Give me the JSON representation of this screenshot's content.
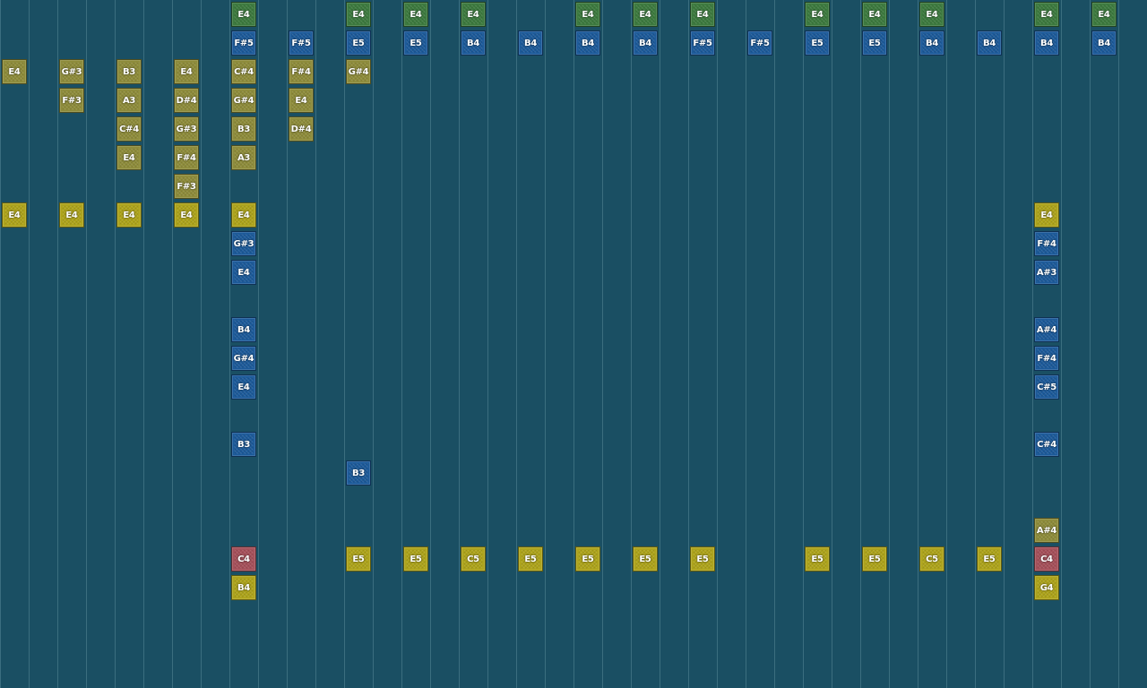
{
  "palette": {
    "green": "#3c7a3e",
    "blue": "#1c5a9a",
    "olive": "#8e8c3a",
    "yellow": "#aea41a",
    "red": "#a6505a"
  },
  "columns": [
    {
      "notes": [
        {
          "row": 2,
          "label": "E4",
          "color": "olive"
        },
        {
          "row": 7,
          "label": "E4",
          "color": "yellow"
        }
      ]
    },
    {
      "notes": []
    },
    {
      "notes": [
        {
          "row": 2,
          "label": "G#3",
          "color": "olive"
        },
        {
          "row": 3,
          "label": "F#3",
          "color": "olive"
        },
        {
          "row": 7,
          "label": "E4",
          "color": "yellow"
        }
      ]
    },
    {
      "notes": []
    },
    {
      "notes": [
        {
          "row": 2,
          "label": "B3",
          "color": "olive"
        },
        {
          "row": 3,
          "label": "A3",
          "color": "olive"
        },
        {
          "row": 4,
          "label": "C#4",
          "color": "olive"
        },
        {
          "row": 5,
          "label": "E4",
          "color": "olive"
        },
        {
          "row": 7,
          "label": "E4",
          "color": "yellow"
        }
      ]
    },
    {
      "notes": []
    },
    {
      "notes": [
        {
          "row": 2,
          "label": "E4",
          "color": "olive"
        },
        {
          "row": 3,
          "label": "D#4",
          "color": "olive"
        },
        {
          "row": 4,
          "label": "G#3",
          "color": "olive"
        },
        {
          "row": 5,
          "label": "F#4",
          "color": "olive"
        },
        {
          "row": 6,
          "label": "F#3",
          "color": "olive"
        },
        {
          "row": 7,
          "label": "E4",
          "color": "yellow"
        }
      ]
    },
    {
      "notes": []
    },
    {
      "notes": [
        {
          "row": 0,
          "label": "E4",
          "color": "green"
        },
        {
          "row": 1,
          "label": "F#5",
          "color": "blue"
        },
        {
          "row": 2,
          "label": "C#4",
          "color": "olive"
        },
        {
          "row": 3,
          "label": "G#4",
          "color": "olive"
        },
        {
          "row": 4,
          "label": "B3",
          "color": "olive"
        },
        {
          "row": 5,
          "label": "A3",
          "color": "olive"
        },
        {
          "row": 7,
          "label": "E4",
          "color": "yellow"
        },
        {
          "row": 8,
          "label": "G#3",
          "color": "blue"
        },
        {
          "row": 9,
          "label": "E4",
          "color": "blue"
        },
        {
          "row": 11,
          "label": "B4",
          "color": "blue"
        },
        {
          "row": 12,
          "label": "G#4",
          "color": "blue"
        },
        {
          "row": 13,
          "label": "E4",
          "color": "blue"
        },
        {
          "row": 15,
          "label": "B3",
          "color": "blue"
        },
        {
          "row": 19,
          "label": "C4",
          "color": "red"
        },
        {
          "row": 20,
          "label": "B4",
          "color": "yellow"
        }
      ]
    },
    {
      "notes": []
    },
    {
      "notes": [
        {
          "row": 1,
          "label": "F#5",
          "color": "blue"
        },
        {
          "row": 2,
          "label": "F#4",
          "color": "olive"
        },
        {
          "row": 3,
          "label": "E4",
          "color": "olive"
        },
        {
          "row": 4,
          "label": "D#4",
          "color": "olive"
        }
      ]
    },
    {
      "notes": []
    },
    {
      "notes": [
        {
          "row": 0,
          "label": "E4",
          "color": "green"
        },
        {
          "row": 1,
          "label": "E5",
          "color": "blue"
        },
        {
          "row": 2,
          "label": "G#4",
          "color": "olive"
        },
        {
          "row": 16,
          "label": "B3",
          "color": "blue"
        },
        {
          "row": 19,
          "label": "E5",
          "color": "yellow"
        }
      ]
    },
    {
      "notes": []
    },
    {
      "notes": [
        {
          "row": 0,
          "label": "E4",
          "color": "green"
        },
        {
          "row": 1,
          "label": "E5",
          "color": "blue"
        },
        {
          "row": 19,
          "label": "E5",
          "color": "yellow"
        }
      ]
    },
    {
      "notes": []
    },
    {
      "notes": [
        {
          "row": 0,
          "label": "E4",
          "color": "green"
        },
        {
          "row": 1,
          "label": "B4",
          "color": "blue"
        },
        {
          "row": 19,
          "label": "C5",
          "color": "yellow"
        }
      ]
    },
    {
      "notes": []
    },
    {
      "notes": [
        {
          "row": 1,
          "label": "B4",
          "color": "blue"
        },
        {
          "row": 19,
          "label": "E5",
          "color": "yellow"
        }
      ]
    },
    {
      "notes": []
    },
    {
      "notes": [
        {
          "row": 0,
          "label": "E4",
          "color": "green"
        },
        {
          "row": 1,
          "label": "B4",
          "color": "blue"
        },
        {
          "row": 19,
          "label": "E5",
          "color": "yellow"
        }
      ]
    },
    {
      "notes": []
    },
    {
      "notes": [
        {
          "row": 0,
          "label": "E4",
          "color": "green"
        },
        {
          "row": 1,
          "label": "B4",
          "color": "blue"
        },
        {
          "row": 19,
          "label": "E5",
          "color": "yellow"
        }
      ]
    },
    {
      "notes": []
    },
    {
      "notes": [
        {
          "row": 0,
          "label": "E4",
          "color": "green"
        },
        {
          "row": 1,
          "label": "F#5",
          "color": "blue"
        },
        {
          "row": 19,
          "label": "E5",
          "color": "yellow"
        }
      ]
    },
    {
      "notes": []
    },
    {
      "notes": [
        {
          "row": 1,
          "label": "F#5",
          "color": "blue"
        }
      ]
    },
    {
      "notes": []
    },
    {
      "notes": [
        {
          "row": 0,
          "label": "E4",
          "color": "green"
        },
        {
          "row": 1,
          "label": "E5",
          "color": "blue"
        },
        {
          "row": 19,
          "label": "E5",
          "color": "yellow"
        }
      ]
    },
    {
      "notes": []
    },
    {
      "notes": [
        {
          "row": 0,
          "label": "E4",
          "color": "green"
        },
        {
          "row": 1,
          "label": "E5",
          "color": "blue"
        },
        {
          "row": 19,
          "label": "E5",
          "color": "yellow"
        }
      ]
    },
    {
      "notes": []
    },
    {
      "notes": [
        {
          "row": 0,
          "label": "E4",
          "color": "green"
        },
        {
          "row": 1,
          "label": "B4",
          "color": "blue"
        },
        {
          "row": 19,
          "label": "C5",
          "color": "yellow"
        }
      ]
    },
    {
      "notes": []
    },
    {
      "notes": [
        {
          "row": 1,
          "label": "B4",
          "color": "blue"
        },
        {
          "row": 19,
          "label": "E5",
          "color": "yellow"
        }
      ]
    },
    {
      "notes": []
    },
    {
      "notes": [
        {
          "row": 0,
          "label": "E4",
          "color": "green"
        },
        {
          "row": 1,
          "label": "B4",
          "color": "blue"
        },
        {
          "row": 7,
          "label": "E4",
          "color": "yellow"
        },
        {
          "row": 8,
          "label": "F#4",
          "color": "blue"
        },
        {
          "row": 9,
          "label": "A#3",
          "color": "blue"
        },
        {
          "row": 11,
          "label": "A#4",
          "color": "blue"
        },
        {
          "row": 12,
          "label": "F#4",
          "color": "blue"
        },
        {
          "row": 13,
          "label": "C#5",
          "color": "blue"
        },
        {
          "row": 15,
          "label": "C#4",
          "color": "blue"
        },
        {
          "row": 18,
          "label": "A#4",
          "color": "olive"
        },
        {
          "row": 19,
          "label": "C4",
          "color": "red"
        },
        {
          "row": 20,
          "label": "G4",
          "color": "yellow"
        }
      ]
    },
    {
      "notes": []
    },
    {
      "notes": [
        {
          "row": 0,
          "label": "E4",
          "color": "green"
        },
        {
          "row": 1,
          "label": "B4",
          "color": "blue"
        }
      ]
    },
    {
      "notes": []
    }
  ]
}
